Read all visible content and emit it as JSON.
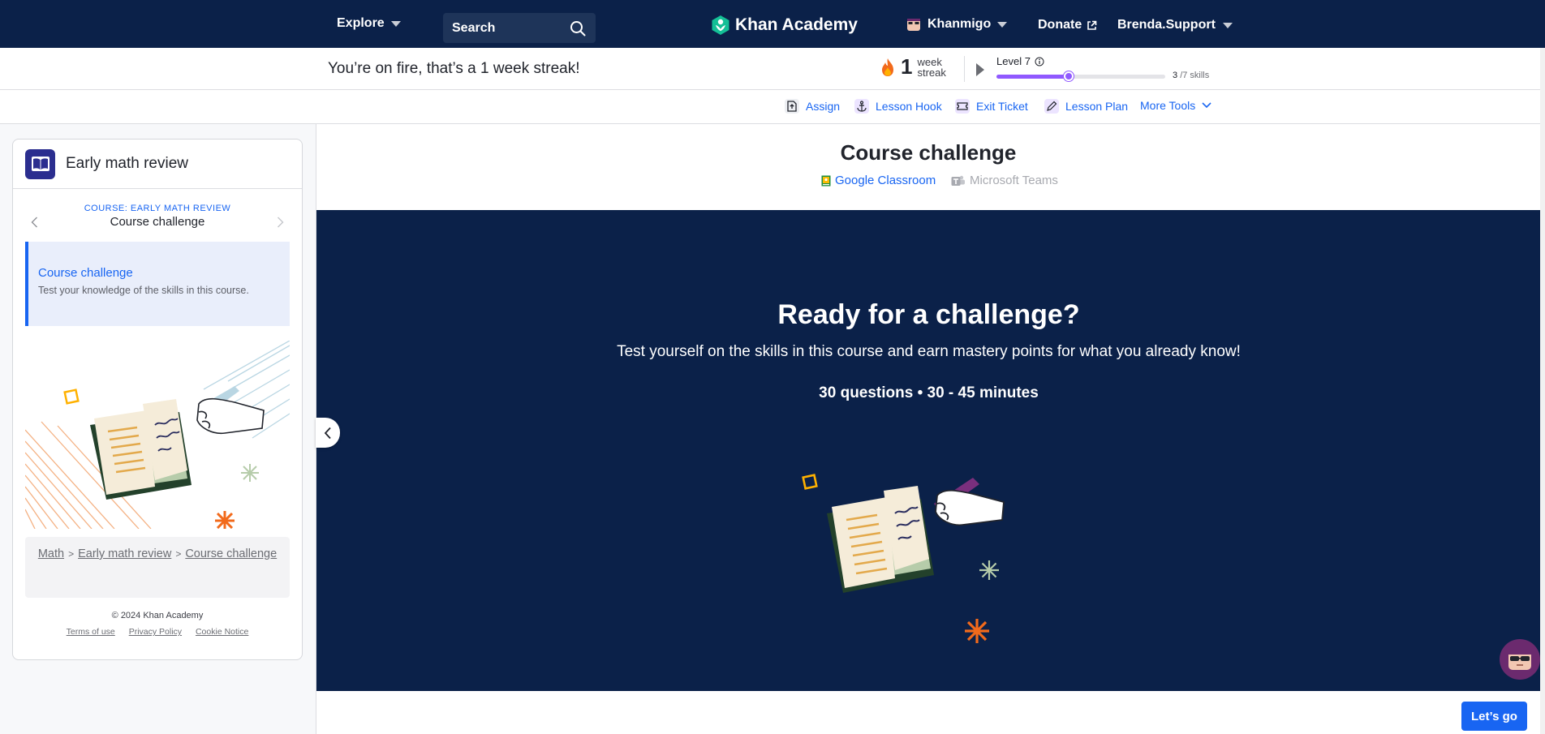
{
  "nav": {
    "explore": "Explore",
    "search_placeholder": "Search",
    "logo": "Khan Academy",
    "khanmigo": "Khanmigo",
    "donate": "Donate",
    "user": "Brenda.Support"
  },
  "streak": {
    "message": "You’re on fire, that’s a 1 week streak!",
    "count": "1",
    "unit_top": "week",
    "unit_bottom": "streak",
    "level": "Level 7",
    "skills_done": "3",
    "skills_total": "/7 skills",
    "progress_fraction": 0.43
  },
  "tools": [
    {
      "label": "Assign"
    },
    {
      "label": "Lesson Hook"
    },
    {
      "label": "Exit Ticket"
    },
    {
      "label": "Lesson Plan"
    },
    {
      "label": "More Tools"
    }
  ],
  "sidebar": {
    "course_title": "Early math review",
    "crumb": "COURSE: EARLY MATH REVIEW",
    "current": "Course challenge",
    "item_title": "Course challenge",
    "item_desc": "Test your knowledge of the skills in this course.",
    "breadcrumb": [
      "Math",
      "Early math review",
      "Course challenge"
    ],
    "copyright": "© 2024 Khan Academy",
    "links": [
      "Terms of use",
      "Privacy Policy",
      "Cookie Notice"
    ]
  },
  "main": {
    "title": "Course challenge",
    "google_classroom": "Google Classroom",
    "microsoft_teams": "Microsoft Teams",
    "hero_title": "Ready for a challenge?",
    "hero_sub": "Test yourself on the skills in this course and earn mastery points for what you already know!",
    "hero_meta": "30 questions • 30 - 45 minutes",
    "cta": "Let’s go"
  },
  "colors": {
    "navy": "#0b2149",
    "accent": "#1865f2",
    "purple": "#9059ff"
  }
}
